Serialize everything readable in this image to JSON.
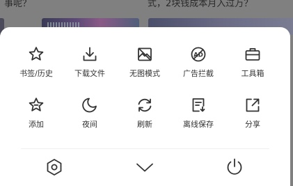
{
  "background": {
    "left_text": "事呢？",
    "right_text": "式，2块钱成本月入过万？"
  },
  "menu": {
    "row1": [
      {
        "label": "书签/历史",
        "icon": "star-icon"
      },
      {
        "label": "下载文件",
        "icon": "download-icon"
      },
      {
        "label": "无图模式",
        "icon": "no-image-icon"
      },
      {
        "label": "广告拦截",
        "icon": "ad-block-icon"
      },
      {
        "label": "工具箱",
        "icon": "toolbox-icon"
      }
    ],
    "row2": [
      {
        "label": "添加",
        "icon": "star-add-icon"
      },
      {
        "label": "夜间",
        "icon": "moon-icon"
      },
      {
        "label": "刷新",
        "icon": "refresh-icon"
      },
      {
        "label": "离线保存",
        "icon": "offline-save-icon"
      },
      {
        "label": "分享",
        "icon": "share-icon"
      }
    ],
    "bottom": [
      {
        "icon": "settings-icon"
      },
      {
        "icon": "chevron-down-icon"
      },
      {
        "icon": "power-icon"
      }
    ]
  },
  "colors": {
    "icon": "#333333",
    "sheet": "#ffffff",
    "overlay": "#808080"
  }
}
